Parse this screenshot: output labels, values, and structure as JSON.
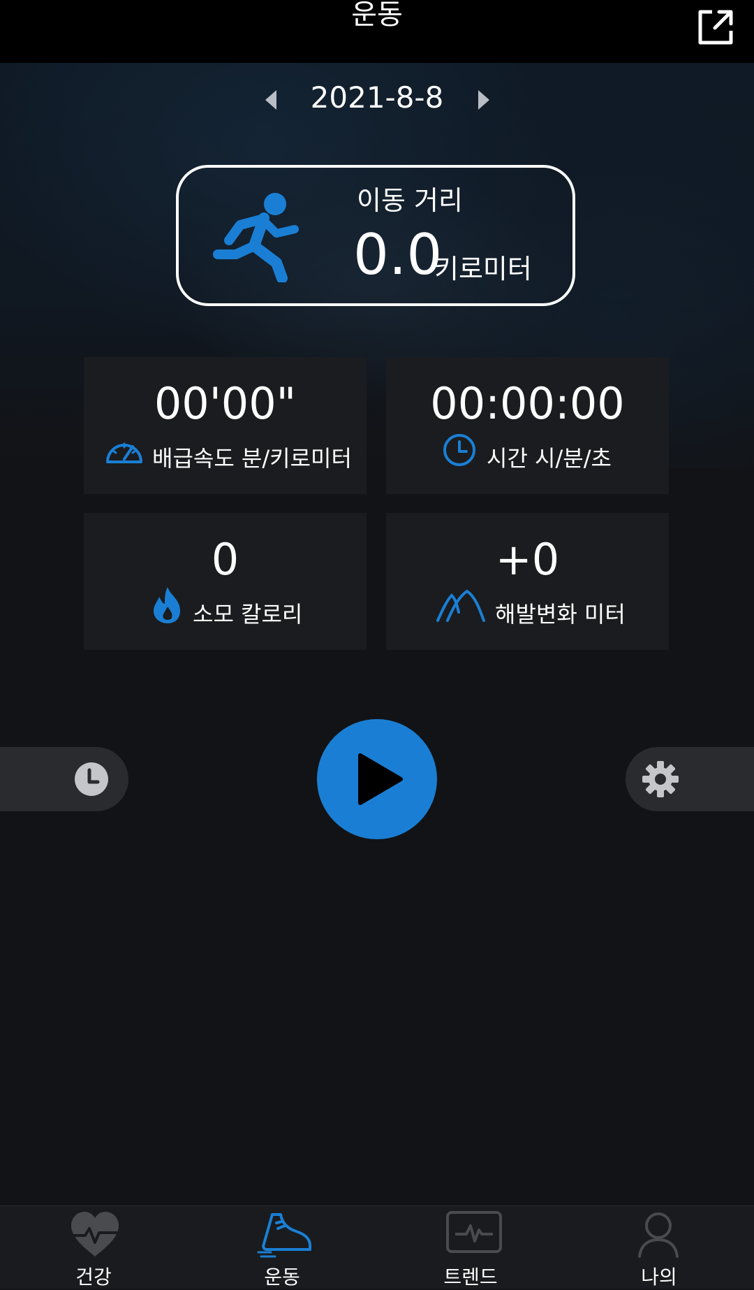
{
  "header": {
    "title": "운동",
    "share_icon": "external-link-icon"
  },
  "date_nav": {
    "date": "2021-8-8",
    "prev_icon": "triangle-left-icon",
    "next_icon": "triangle-right-icon"
  },
  "distance": {
    "label": "이동 거리",
    "value": "0.0",
    "unit": "키로미터",
    "icon": "runner-icon"
  },
  "stats": {
    "pace": {
      "value": "00'00\"",
      "label": "배급속도 분/키로미터",
      "icon": "speedometer-icon"
    },
    "time": {
      "value": "00:00:00",
      "label": "시간 시/분/초",
      "icon": "clock-icon"
    },
    "calories": {
      "value": "0",
      "label": "소모 칼로리",
      "icon": "flame-icon"
    },
    "elevation": {
      "value": "+0",
      "label": "해발변화 미터",
      "icon": "mountain-icon"
    }
  },
  "controls": {
    "history_icon": "history-clock-icon",
    "play_icon": "play-icon",
    "settings_icon": "gear-icon"
  },
  "bottom_nav": [
    {
      "label": "건강",
      "icon": "heart-pulse-icon",
      "active": false
    },
    {
      "label": "운동",
      "icon": "sneaker-icon",
      "active": true
    },
    {
      "label": "트렌드",
      "icon": "monitor-pulse-icon",
      "active": false
    },
    {
      "label": "나의",
      "icon": "person-icon",
      "active": false
    }
  ],
  "colors": {
    "accent": "#1a7fd4",
    "background": "#121316",
    "tile": "#1b1c1f"
  }
}
